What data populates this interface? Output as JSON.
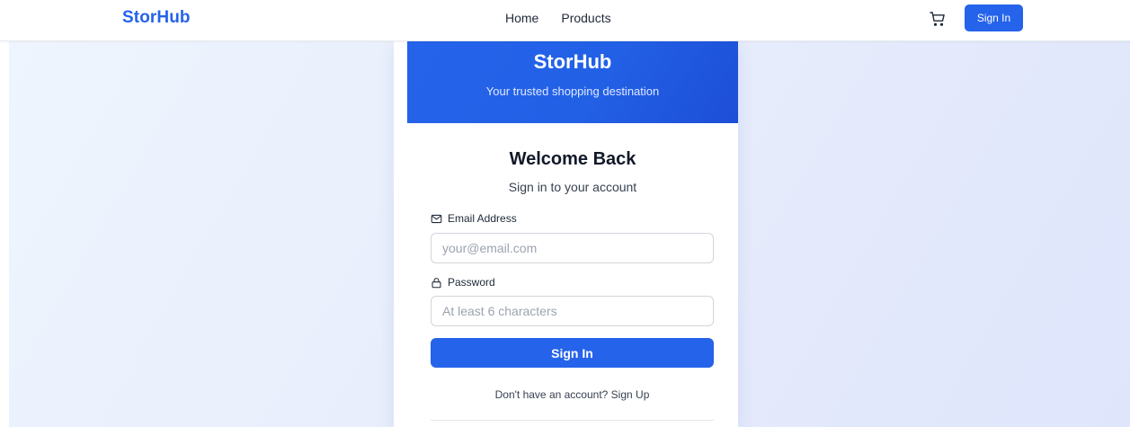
{
  "navbar": {
    "brand": "StorHub",
    "links": [
      "Home",
      "Products"
    ],
    "cart_icon": "cart-icon",
    "signin_label": "Sign In"
  },
  "card": {
    "header_title": "StorHub",
    "header_subtitle": "Your trusted shopping destination",
    "heading": "Welcome Back",
    "subheading": "Sign in to your account",
    "email": {
      "label": "Email Address",
      "icon": "mail-icon",
      "value": "",
      "placeholder": "your@email.com"
    },
    "password": {
      "label": "Password",
      "icon": "lock-icon",
      "value": "",
      "placeholder": "At least 6 characters"
    },
    "submit_label": "Sign In",
    "signup_prompt": "Don't have an account?",
    "signup_link": "Sign Up"
  },
  "colors": {
    "accent": "#2563eb",
    "accent_dark": "#1d4ed8",
    "background": "#e7edfb",
    "text": "#111827"
  }
}
